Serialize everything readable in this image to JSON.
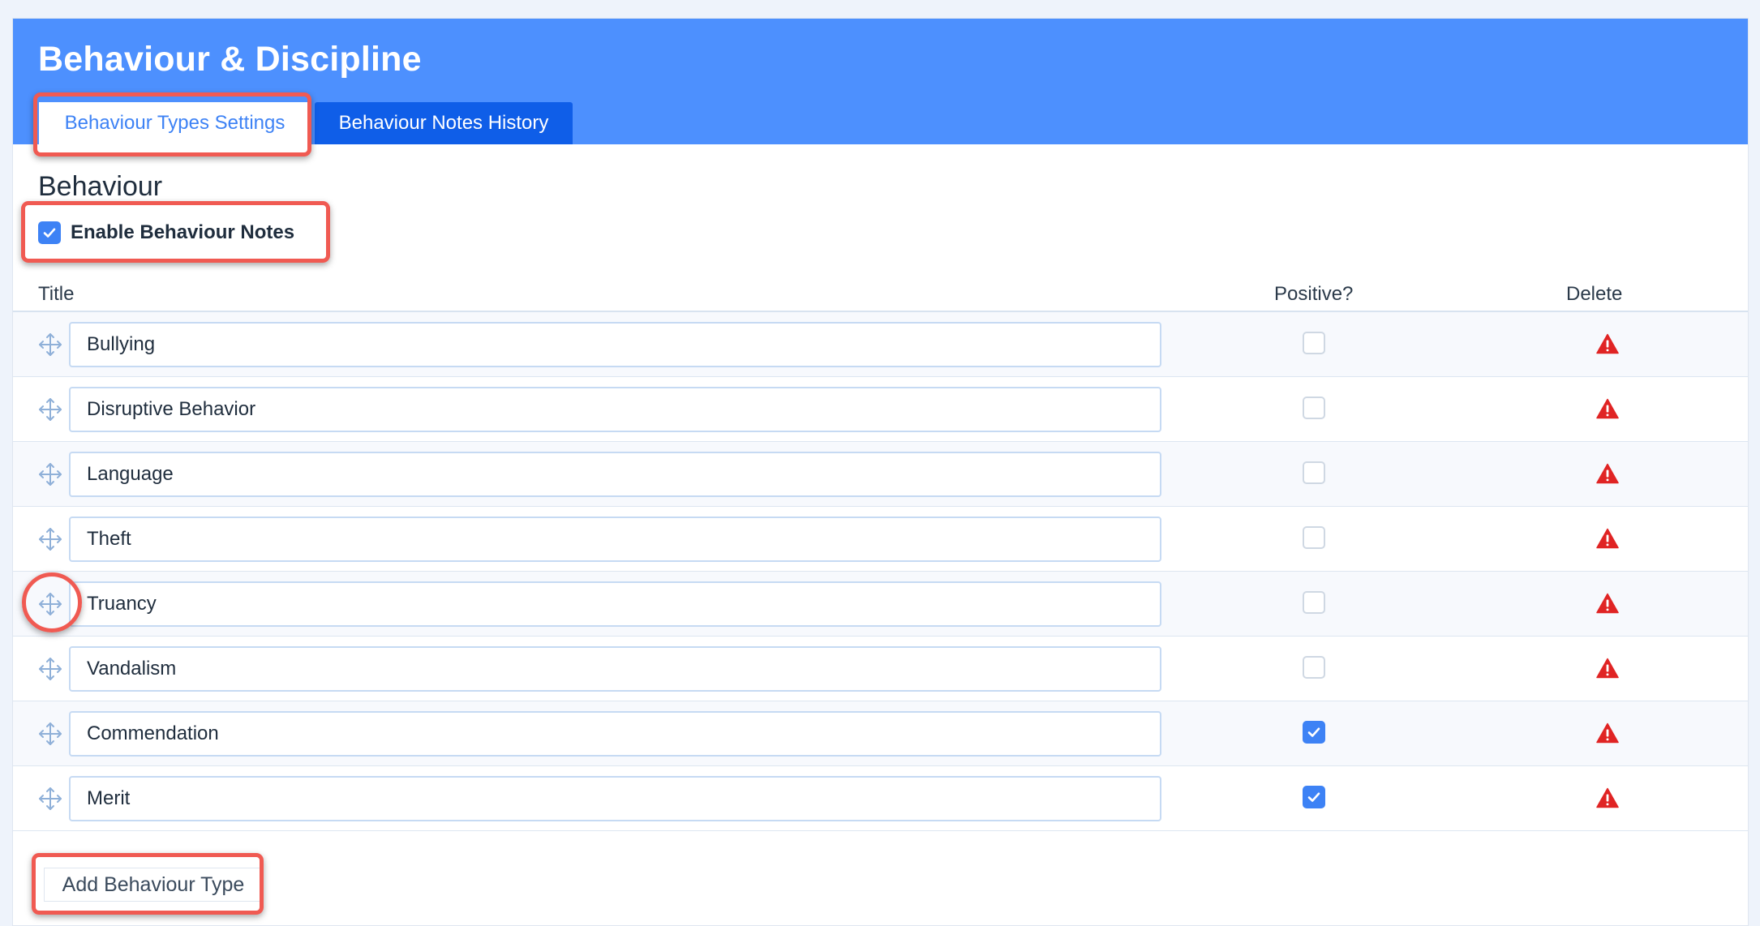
{
  "app": {
    "title": "Behaviour & Discipline"
  },
  "tabs": [
    {
      "label": "Behaviour Types Settings",
      "active": true
    },
    {
      "label": "Behaviour Notes History",
      "active": false
    }
  ],
  "section": {
    "title": "Behaviour"
  },
  "enable_notes": {
    "label": "Enable Behaviour Notes",
    "checked": true
  },
  "table": {
    "headers": {
      "title": "Title",
      "positive": "Positive?",
      "delete": "Delete"
    },
    "rows": [
      {
        "title": "Bullying",
        "positive": false
      },
      {
        "title": "Disruptive Behavior",
        "positive": false
      },
      {
        "title": "Language",
        "positive": false
      },
      {
        "title": "Theft",
        "positive": false
      },
      {
        "title": "Truancy",
        "positive": false
      },
      {
        "title": "Vandalism",
        "positive": false
      },
      {
        "title": "Commendation",
        "positive": true
      },
      {
        "title": "Merit",
        "positive": true
      }
    ]
  },
  "actions": {
    "add_label": "Add Behaviour Type"
  },
  "icons": {
    "drag": "move-arrows-icon",
    "delete": "warning-triangle-icon",
    "check": "checkmark-icon"
  },
  "colors": {
    "header": "#4d90fe",
    "active_tab_text": "#3d82f5",
    "inactive_tab_bg": "#0f5ee8",
    "checkbox_checked": "#3d82f5",
    "delete_icon": "#e02424",
    "annotation": "#f05a52"
  }
}
